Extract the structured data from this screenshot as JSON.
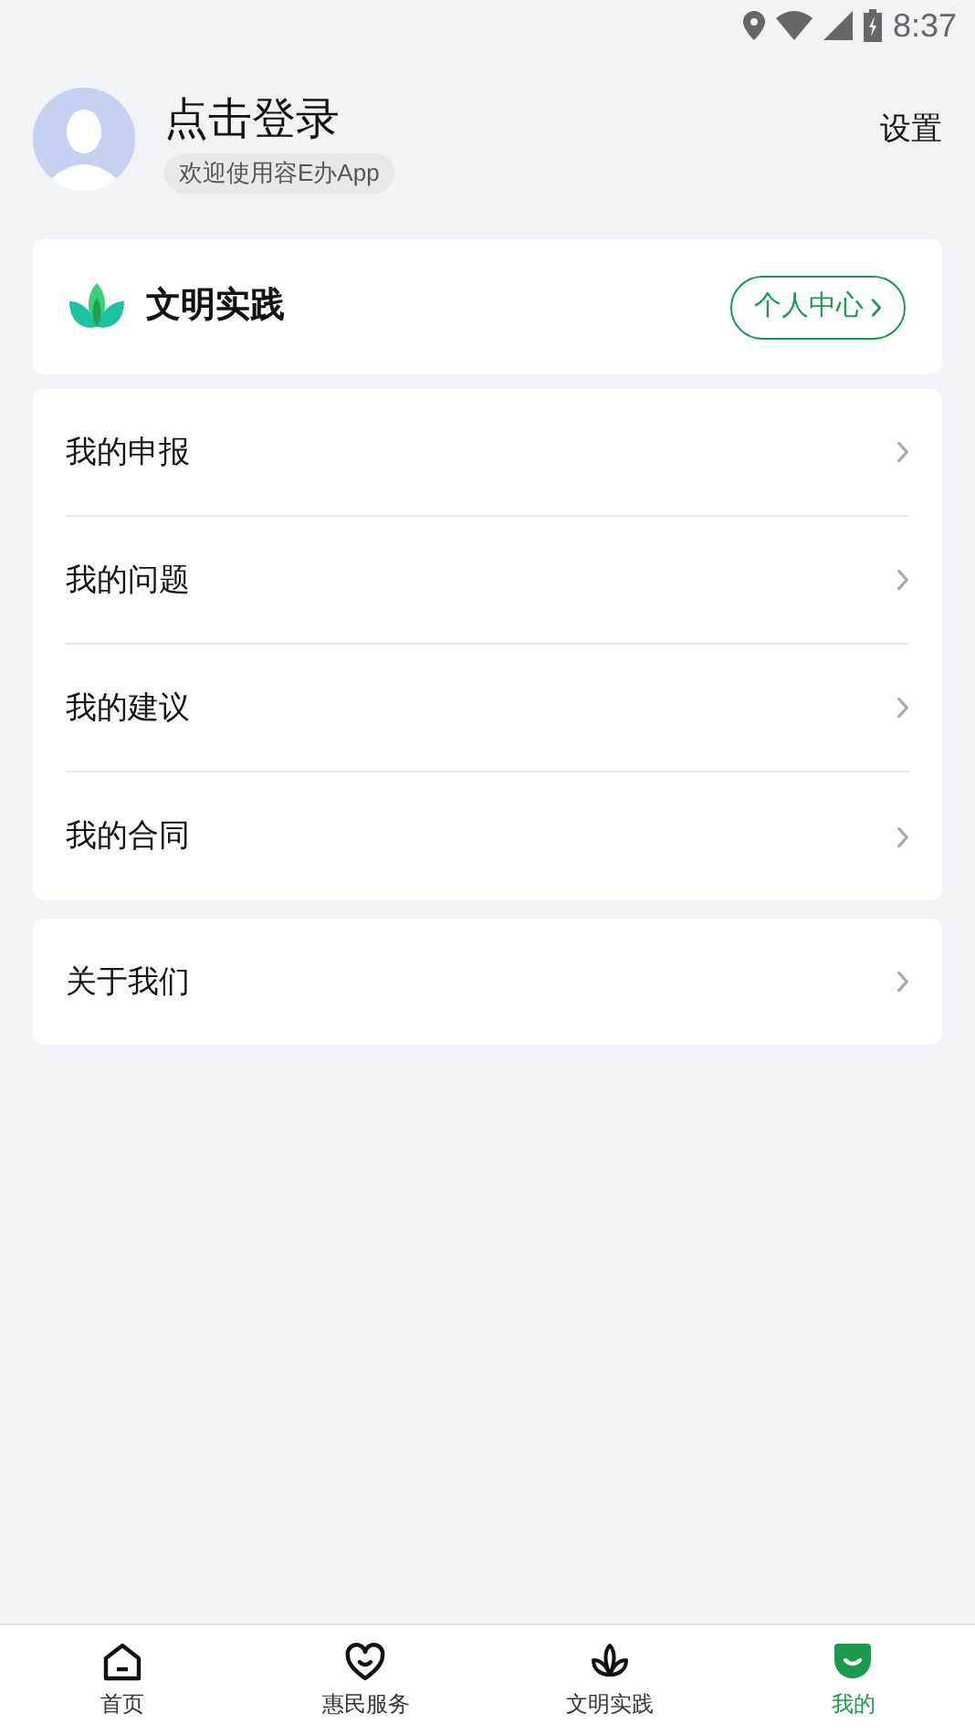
{
  "status_bar": {
    "time": "8:37"
  },
  "profile": {
    "name": "点击登录",
    "subtitle": "欢迎使用容E办App",
    "settings": "设置"
  },
  "practice_card": {
    "title": "文明实践",
    "button": "个人中心"
  },
  "menu": [
    {
      "label": "我的申报"
    },
    {
      "label": "我的问题"
    },
    {
      "label": "我的建议"
    },
    {
      "label": "我的合同"
    }
  ],
  "about": {
    "label": "关于我们"
  },
  "tabs": [
    {
      "kind": "home",
      "label": "首页",
      "selected": false
    },
    {
      "kind": "heart",
      "label": "惠民服务",
      "selected": false
    },
    {
      "kind": "lotus",
      "label": "文明实践",
      "selected": false
    },
    {
      "kind": "face",
      "label": "我的",
      "selected": true
    }
  ]
}
